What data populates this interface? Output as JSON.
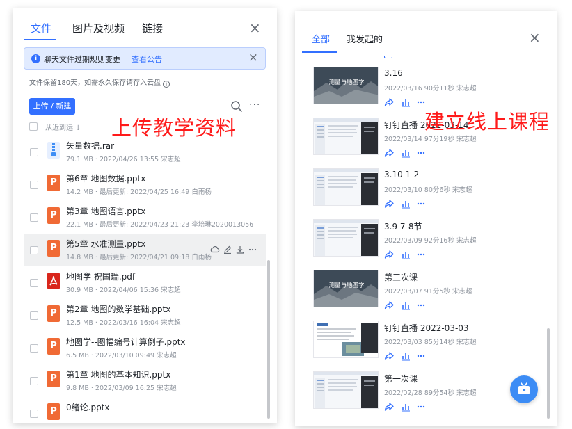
{
  "left_panel": {
    "tabs": [
      {
        "label": "文件",
        "active": true
      },
      {
        "label": "图片及视频",
        "active": false
      },
      {
        "label": "链接",
        "active": false
      }
    ],
    "notice": {
      "text": "聊天文件过期规则变更",
      "link": "查看公告"
    },
    "retention_text": "文件保留180天，如需永久保存请存入云盘",
    "upload_button": "上传 / 新建",
    "sort_label": "从近到远 ↓",
    "files": [
      {
        "name": "矢量数据.rar",
        "meta": "79.1 MB · 2022/04/26 13:55 宋志超",
        "type": "rar"
      },
      {
        "name": "第6章 地图数据.pptx",
        "meta": "14.2 MB · 最后更新: 2022/04/25 16:49 白雨杨",
        "type": "ppt"
      },
      {
        "name": "第3章 地图语言.pptx",
        "meta": "22.1 MB · 最后更新: 2022/04/23 21:23 李培琳2020013056",
        "type": "ppt"
      },
      {
        "name": "第5章 水准测量.pptx",
        "meta": "14.8 MB · 最后更新: 2022/04/21 09:18 白雨杨",
        "type": "ppt"
      },
      {
        "name": "地图学 祝国瑞.pdf",
        "meta": "30.9 MB · 2022/04/06 15:36 宋志超",
        "type": "pdf"
      },
      {
        "name": "第2章 地图的数学基础.pptx",
        "meta": "12.5 MB · 2022/03/16 16:04 宋志超",
        "type": "ppt"
      },
      {
        "name": "地图学--图幅编号计算例子.pptx",
        "meta": "6.5 MB · 2022/03/10 09:49 宋志超",
        "type": "ppt"
      },
      {
        "name": "第1章 地图的基本知识.pptx",
        "meta": "9.8 MB · 2022/03/09 16:25 宋志超",
        "type": "ppt"
      },
      {
        "name": "0绪论.pptx",
        "meta": "",
        "type": "ppt"
      }
    ],
    "overlay_text": "上传教学资料"
  },
  "right_panel": {
    "tabs": [
      {
        "label": "全部",
        "active": true
      },
      {
        "label": "我发起的",
        "active": false
      }
    ],
    "videos": [
      {
        "title": "3.16",
        "meta": "2022/03/16 90分11秒 宋志超",
        "thumb": "mountain",
        "thumb_text": "测量与地图学"
      },
      {
        "title": "钉钉直播 2022-03-14",
        "meta": "2022/03/14 97分19秒 宋志超",
        "thumb": "screen",
        "thumb_text": ""
      },
      {
        "title": "3.10 1-2",
        "meta": "2022/03/10 80分6秒 宋志超",
        "thumb": "screen",
        "thumb_text": ""
      },
      {
        "title": "3.9 7-8节",
        "meta": "2022/03/09 92分16秒 宋志超",
        "thumb": "screen",
        "thumb_text": ""
      },
      {
        "title": "第三次课",
        "meta": "2022/03/07 91分5秒 宋志超",
        "thumb": "mountain",
        "thumb_text": "测量与地图学"
      },
      {
        "title": "钉钉直播 2022-03-03",
        "meta": "2022/03/03 85分14秒 宋志超",
        "thumb": "doc",
        "thumb_text": ""
      },
      {
        "title": "第一次课",
        "meta": "2022/02/28 89分54秒 宋志超",
        "thumb": "screen",
        "thumb_text": ""
      }
    ],
    "overlay_text": "建立线上课程"
  },
  "colors": {
    "accent": "#3370ff",
    "overlay_red": "#ff1a1a",
    "ppt_orange": "#f06a35",
    "pdf_red": "#d9261c"
  }
}
